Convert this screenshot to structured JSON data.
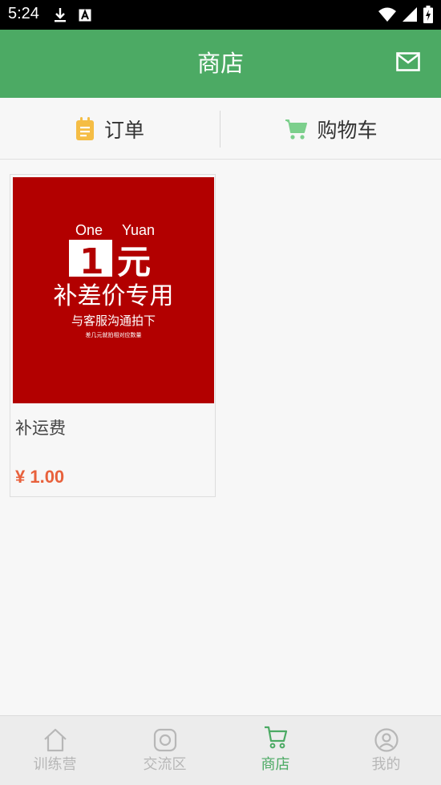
{
  "status_bar": {
    "time": "5:24",
    "icons": [
      "download-icon",
      "font-icon",
      "wifi-icon",
      "signal-icon",
      "battery-icon"
    ]
  },
  "app_bar": {
    "title": "商店",
    "action_icon": "mail-icon"
  },
  "tabs": [
    {
      "label": "订单",
      "icon": "clipboard-icon",
      "icon_color": "#f5bd45"
    },
    {
      "label": "购物车",
      "icon": "cart-icon",
      "icon_color": "#7ccf8c"
    }
  ],
  "products": [
    {
      "image": {
        "top_left": "One",
        "top_right": "Yuan",
        "big_number": "1",
        "big_char": "元",
        "line1": "补差价专用",
        "line2": "与客服沟通拍下",
        "line3": "差几元就拍相对应数量"
      },
      "name": "补运费",
      "price": "¥ 1.00"
    }
  ],
  "bottom_nav": {
    "items": [
      {
        "label": "训练营",
        "icon": "home-icon",
        "active": false
      },
      {
        "label": "交流区",
        "icon": "camera-icon",
        "active": false
      },
      {
        "label": "商店",
        "icon": "cart-icon",
        "active": true
      },
      {
        "label": "我的",
        "icon": "profile-icon",
        "active": false
      }
    ]
  },
  "colors": {
    "brand_green": "#4caa64",
    "price_orange": "#e8613c",
    "product_red": "#b20000",
    "inactive_gray": "#b7b7b7"
  }
}
